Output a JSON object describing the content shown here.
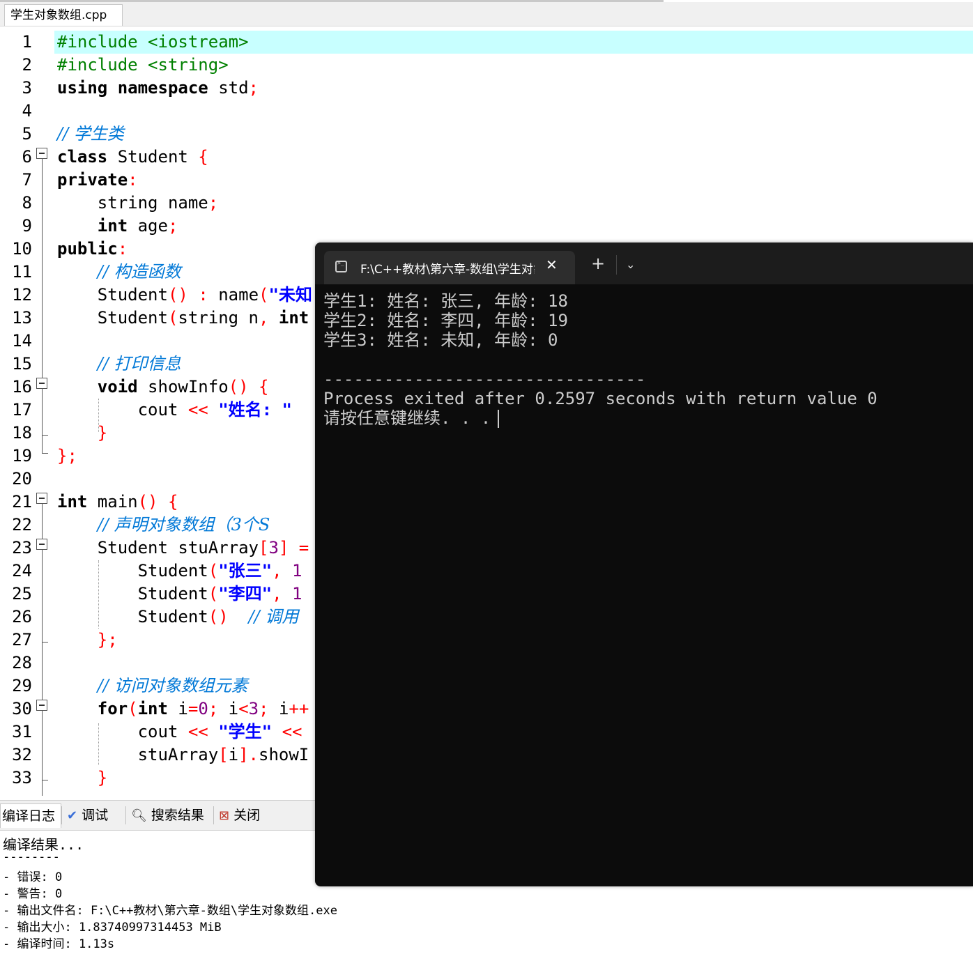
{
  "editor": {
    "file_tab": "学生对象数组.cpp",
    "lines": [
      {
        "n": "1",
        "segs": [
          [
            "pp",
            "#include <iostream>"
          ]
        ]
      },
      {
        "n": "2",
        "segs": [
          [
            "pp",
            "#include <string>"
          ]
        ]
      },
      {
        "n": "3",
        "segs": [
          [
            "kw",
            "using"
          ],
          [
            "t",
            " "
          ],
          [
            "kw",
            "namespace"
          ],
          [
            "t",
            " std"
          ],
          [
            "sym",
            ";"
          ]
        ]
      },
      {
        "n": "4",
        "segs": []
      },
      {
        "n": "5",
        "segs": [
          [
            "cm",
            "// 学生类"
          ]
        ]
      },
      {
        "n": "6",
        "segs": [
          [
            "kw",
            "class"
          ],
          [
            "t",
            " Student "
          ],
          [
            "sym",
            "{"
          ]
        ]
      },
      {
        "n": "7",
        "segs": [
          [
            "kw",
            "private"
          ],
          [
            "sym",
            ":"
          ]
        ]
      },
      {
        "n": "8",
        "segs": [
          [
            "t",
            "    string name"
          ],
          [
            "sym",
            ";"
          ]
        ]
      },
      {
        "n": "9",
        "segs": [
          [
            "t",
            "    "
          ],
          [
            "kw",
            "int"
          ],
          [
            "t",
            " age"
          ],
          [
            "sym",
            ";"
          ]
        ]
      },
      {
        "n": "10",
        "segs": [
          [
            "kw",
            "public"
          ],
          [
            "sym",
            ":"
          ]
        ]
      },
      {
        "n": "11",
        "segs": [
          [
            "t",
            "    "
          ],
          [
            "cm",
            "// 构造函数"
          ]
        ]
      },
      {
        "n": "12",
        "segs": [
          [
            "t",
            "    Student"
          ],
          [
            "sym",
            "()"
          ],
          [
            "t",
            " "
          ],
          [
            "sym",
            ":"
          ],
          [
            "t",
            " name"
          ],
          [
            "sym",
            "("
          ],
          [
            "str",
            "\"未知"
          ]
        ]
      },
      {
        "n": "13",
        "segs": [
          [
            "t",
            "    Student"
          ],
          [
            "sym",
            "("
          ],
          [
            "t",
            "string n"
          ],
          [
            "sym",
            ","
          ],
          [
            "t",
            " "
          ],
          [
            "kw",
            "int"
          ]
        ]
      },
      {
        "n": "14",
        "segs": []
      },
      {
        "n": "15",
        "segs": [
          [
            "t",
            "    "
          ],
          [
            "cm",
            "// 打印信息"
          ]
        ]
      },
      {
        "n": "16",
        "segs": [
          [
            "t",
            "    "
          ],
          [
            "kw",
            "void"
          ],
          [
            "t",
            " showInfo"
          ],
          [
            "sym",
            "()"
          ],
          [
            "t",
            " "
          ],
          [
            "sym",
            "{"
          ]
        ]
      },
      {
        "n": "17",
        "segs": [
          [
            "t",
            "        cout "
          ],
          [
            "sym",
            "<<"
          ],
          [
            "t",
            " "
          ],
          [
            "str",
            "\"姓名: \""
          ]
        ]
      },
      {
        "n": "18",
        "segs": [
          [
            "t",
            "    "
          ],
          [
            "sym",
            "}"
          ]
        ]
      },
      {
        "n": "19",
        "segs": [
          [
            "sym",
            "};"
          ]
        ]
      },
      {
        "n": "20",
        "segs": []
      },
      {
        "n": "21",
        "segs": [
          [
            "kw",
            "int"
          ],
          [
            "t",
            " main"
          ],
          [
            "sym",
            "()"
          ],
          [
            "t",
            " "
          ],
          [
            "sym",
            "{"
          ]
        ]
      },
      {
        "n": "22",
        "segs": [
          [
            "t",
            "    "
          ],
          [
            "cm",
            "// 声明对象数组（3个S"
          ]
        ]
      },
      {
        "n": "23",
        "segs": [
          [
            "t",
            "    Student stuArray"
          ],
          [
            "sym",
            "["
          ],
          [
            "num",
            "3"
          ],
          [
            "sym",
            "]"
          ],
          [
            "t",
            " "
          ],
          [
            "sym",
            "="
          ]
        ]
      },
      {
        "n": "24",
        "segs": [
          [
            "t",
            "        Student"
          ],
          [
            "sym",
            "("
          ],
          [
            "str",
            "\"张三\""
          ],
          [
            "sym",
            ","
          ],
          [
            "t",
            " "
          ],
          [
            "num",
            "1"
          ]
        ]
      },
      {
        "n": "25",
        "segs": [
          [
            "t",
            "        Student"
          ],
          [
            "sym",
            "("
          ],
          [
            "str",
            "\"李四\""
          ],
          [
            "sym",
            ","
          ],
          [
            "t",
            " "
          ],
          [
            "num",
            "1"
          ]
        ]
      },
      {
        "n": "26",
        "segs": [
          [
            "t",
            "        Student"
          ],
          [
            "sym",
            "()"
          ],
          [
            "t",
            "  "
          ],
          [
            "cm",
            "// 调用"
          ]
        ]
      },
      {
        "n": "27",
        "segs": [
          [
            "t",
            "    "
          ],
          [
            "sym",
            "};"
          ]
        ]
      },
      {
        "n": "28",
        "segs": []
      },
      {
        "n": "29",
        "segs": [
          [
            "t",
            "    "
          ],
          [
            "cm",
            "// 访问对象数组元素"
          ]
        ]
      },
      {
        "n": "30",
        "segs": [
          [
            "t",
            "    "
          ],
          [
            "kw",
            "for"
          ],
          [
            "sym",
            "("
          ],
          [
            "kw",
            "int"
          ],
          [
            "t",
            " i"
          ],
          [
            "sym",
            "="
          ],
          [
            "num",
            "0"
          ],
          [
            "sym",
            ";"
          ],
          [
            "t",
            " i"
          ],
          [
            "sym",
            "<"
          ],
          [
            "num",
            "3"
          ],
          [
            "sym",
            ";"
          ],
          [
            "t",
            " i"
          ],
          [
            "sym",
            "++"
          ]
        ]
      },
      {
        "n": "31",
        "segs": [
          [
            "t",
            "        cout "
          ],
          [
            "sym",
            "<<"
          ],
          [
            "t",
            " "
          ],
          [
            "str",
            "\"学生\""
          ],
          [
            "t",
            " "
          ],
          [
            "sym",
            "<<"
          ]
        ]
      },
      {
        "n": "32",
        "segs": [
          [
            "t",
            "        stuArray"
          ],
          [
            "sym",
            "["
          ],
          [
            "t",
            "i"
          ],
          [
            "sym",
            "]."
          ],
          [
            "t",
            "showI"
          ]
        ]
      },
      {
        "n": "33",
        "segs": [
          [
            "t",
            "    "
          ],
          [
            "sym",
            "}"
          ]
        ]
      }
    ]
  },
  "bottom_panel": {
    "tabs": [
      {
        "label": "编译日志",
        "icon": "compile-log-icon"
      },
      {
        "label": "调试",
        "icon": "debug-check-icon"
      },
      {
        "label": "搜索结果",
        "icon": "search-results-icon"
      },
      {
        "label": "关闭",
        "icon": "close-panel-icon"
      }
    ],
    "log": [
      "编译结果...",
      "--------",
      "- 错误: 0",
      "- 警告: 0",
      "- 输出文件名: F:\\C++教材\\第六章-数组\\学生对象数组.exe",
      "- 输出大小: 1.83740997314453 MiB",
      "- 编译时间: 1.13s"
    ]
  },
  "console": {
    "tab_title": "F:\\C++教材\\第六章-数组\\学生对象数组.exe",
    "close_glyph": "✕",
    "new_tab_glyph": "+",
    "dropdown_glyph": "⌄",
    "output": [
      "学生1: 姓名: 张三, 年龄: 18",
      "学生2: 姓名: 李四, 年龄: 19",
      "学生3: 姓名: 未知, 年龄: 0",
      "",
      "--------------------------------",
      "Process exited after 0.2597 seconds with return value 0",
      "请按任意键继续. . ."
    ]
  },
  "colors": {
    "current_line_highlight": "#c8ffff",
    "preprocessor": "#008000",
    "symbol": "#ff0000",
    "string": "#0000ff",
    "number": "#800080",
    "comment": "#0078d7",
    "console_bg": "#0c0c0c",
    "console_text": "#cccccc"
  }
}
